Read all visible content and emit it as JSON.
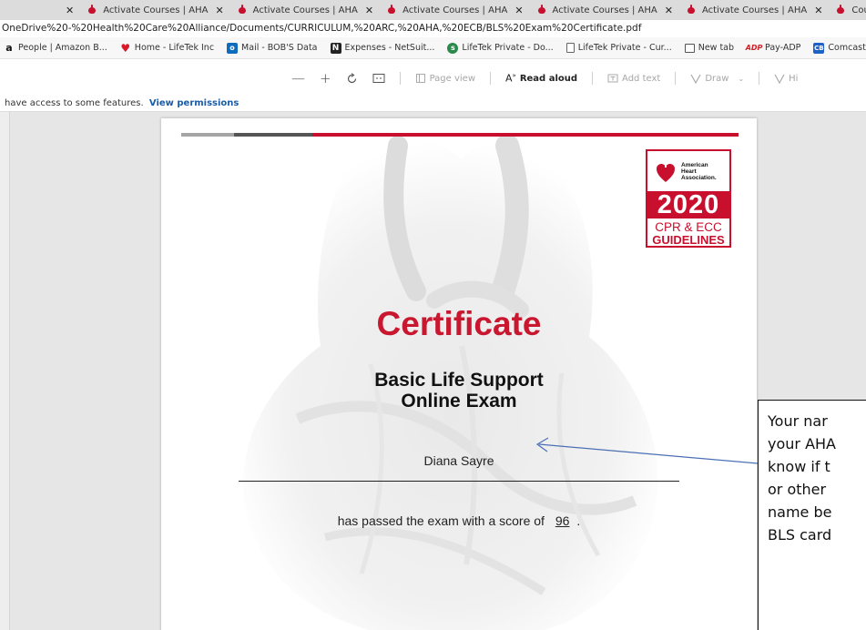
{
  "browser": {
    "first_tab_close": "✕",
    "tabs": [
      {
        "title": "Activate Courses | AHA",
        "close": "✕"
      },
      {
        "title": "Activate Courses | AHA",
        "close": "✕"
      },
      {
        "title": "Activate Courses | AHA",
        "close": "✕"
      },
      {
        "title": "Activate Courses | AHA",
        "close": "✕"
      },
      {
        "title": "Activate Courses | AHA",
        "close": "✕"
      },
      {
        "title": "Course Launch | AHA",
        "close": "✕"
      }
    ],
    "address": "OneDrive%20-%20Health%20Care%20Alliance/Documents/CURRICULUM,%20ARC,%20AHA,%20ECB/BLS%20Exam%20Certificate.pdf",
    "favorites": [
      {
        "label": "People | Amazon B...",
        "icon": "amazon-icon"
      },
      {
        "label": "Home - LifeTek Inc",
        "icon": "heart-icon"
      },
      {
        "label": "Mail - BOB'S Data",
        "icon": "outlook-icon"
      },
      {
        "label": "Expenses - NetSuit...",
        "icon": "netsuite-icon"
      },
      {
        "label": "LifeTek Private - Do...",
        "icon": "sharepoint-icon"
      },
      {
        "label": "LifeTek Private - Cur...",
        "icon": "page-icon"
      },
      {
        "label": "New tab",
        "icon": "new-tab-icon"
      },
      {
        "label": "Pay-ADP",
        "icon": "adp-icon"
      },
      {
        "label": "Comcast Business -...",
        "icon": "comcast-icon"
      }
    ]
  },
  "pdf_toolbar": {
    "zoom_out": "—",
    "zoom_in": "+",
    "page_view": "Page view",
    "read_aloud": "Read aloud",
    "add_text": "Add text",
    "draw": "Draw",
    "highlight": "Hi"
  },
  "notice": {
    "text": "have access to some features.",
    "link": "View permissions"
  },
  "certificate": {
    "badge_org": "American\nHeart\nAssociation.",
    "badge_year": "2020",
    "badge_line1": "CPR & ECC",
    "badge_line2": "GUIDELINES",
    "title": "Certificate",
    "subtitle_line1": "Basic Life Support",
    "subtitle_line2": "Online Exam",
    "name": "Diana Sayre",
    "score_prefix": "has passed the exam with a score of",
    "score": "96",
    "score_suffix": ".",
    "colors": {
      "red": "#c8102e",
      "stripe_light": "#a5a5a5",
      "stripe_dark": "#555555"
    }
  },
  "callout": {
    "lines": [
      "Your nar",
      "your AHA",
      "know if t",
      "or other",
      "name be",
      "BLS card"
    ]
  }
}
